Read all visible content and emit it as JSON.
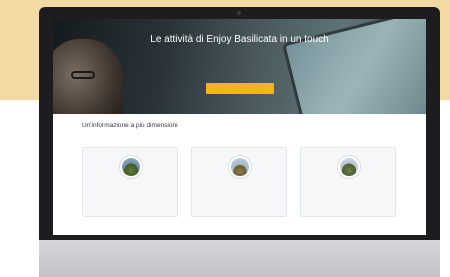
{
  "hero": {
    "title": "Le attività di Enjoy Basilicata in un touch",
    "subtitle": "",
    "cta_label": ""
  },
  "section": {
    "title": "Un'informazione a più dimensioni",
    "subtitle": ""
  },
  "cards": [
    {
      "title": "",
      "text": "",
      "icon": "landscape-icon"
    },
    {
      "title": "",
      "text": "",
      "icon": "landscape-icon"
    },
    {
      "title": "",
      "text": "",
      "icon": "landscape-icon"
    }
  ],
  "colors": {
    "backdrop_top": "#f3d9a3",
    "cta": "#f2b51c",
    "monitor_bezel": "#1d1d1f"
  }
}
